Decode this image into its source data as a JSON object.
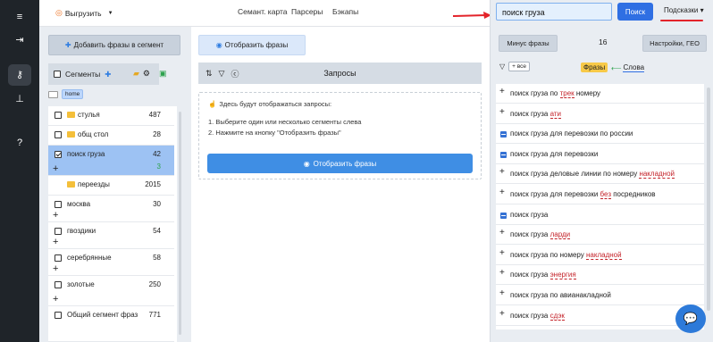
{
  "rail": {
    "icons": [
      "menu-icon",
      "logout-icon",
      "key-icon",
      "sitemap-icon",
      "help-icon"
    ]
  },
  "header": {
    "export_label": "Выгрузить",
    "nav": [
      "Семант. карта",
      "Парсеры",
      "Бэкапы"
    ]
  },
  "segments": {
    "add_label": "Добавить фразы в сегмент",
    "title": "Сегменты",
    "home_tag": "home",
    "items": [
      {
        "name": "стулья",
        "count": "487",
        "folder": true,
        "checkbox": true,
        "plus": false
      },
      {
        "name": "общ стол",
        "count": "28",
        "folder": true,
        "checkbox": true,
        "plus": false
      },
      {
        "name": "поиск груза",
        "count": "42",
        "sub": "3",
        "folder": false,
        "checkbox": true,
        "selected": true,
        "plus": true
      },
      {
        "name": "переезды",
        "count": "2015",
        "folder": true,
        "checkbox": false,
        "plus": false
      },
      {
        "name": "москва",
        "count": "30",
        "folder": false,
        "checkbox": true,
        "plus": true
      },
      {
        "name": "гвоздики",
        "count": "54",
        "folder": false,
        "checkbox": true,
        "plus": true
      },
      {
        "name": "серебрянные",
        "count": "58",
        "folder": false,
        "checkbox": true,
        "plus": true
      },
      {
        "name": "золотые",
        "count": "250",
        "folder": false,
        "checkbox": true,
        "plus": true
      },
      {
        "name": "Общий сегмент фраз",
        "count": "771",
        "folder": false,
        "checkbox": true,
        "plus": false
      }
    ]
  },
  "queries": {
    "show_top_label": "Отобразить фразы",
    "title": "Запросы",
    "hint": "Здесь будут отображаться запросы:",
    "steps": [
      "1. Выберите один или несколько сегменты слева",
      "2. Нажмите на кнопку \"Отобразить фразы\""
    ],
    "show_label": "Отобразить фразы"
  },
  "search": {
    "value": "поиск груза",
    "button": "Поиск",
    "hints_label": "Подсказки"
  },
  "results": {
    "minus_label": "Минус фразы",
    "count": "16",
    "settings_label": "Настройки, ГЕО",
    "all_label": "+ все",
    "phrases_label": "Фразы",
    "words_label": "Слова",
    "rows": [
      {
        "type": "plus",
        "text": "поиск груза по ",
        "hl": "трек",
        "tail": " номеру"
      },
      {
        "type": "plus",
        "text": "поиск груза ",
        "hl": "ати",
        "tail": ""
      },
      {
        "type": "minus",
        "text": "поиск груза для перевозки по россии",
        "hl": "",
        "tail": ""
      },
      {
        "type": "minus",
        "text": "поиск груза для перевозки",
        "hl": "",
        "tail": ""
      },
      {
        "type": "plus",
        "text": "поиск груза деловые линии по номеру ",
        "hl": "накладной",
        "tail": ""
      },
      {
        "type": "plus",
        "text": "поиск груза для перевозки ",
        "hl": "без",
        "tail": " посредников"
      },
      {
        "type": "minus",
        "text": "поиск груза",
        "hl": "",
        "tail": ""
      },
      {
        "type": "plus",
        "text": "поиск груза ",
        "hl": "ларди",
        "tail": ""
      },
      {
        "type": "plus",
        "text": "поиск груза по номеру ",
        "hl": "накладной",
        "tail": ""
      },
      {
        "type": "plus",
        "text": "поиск груза ",
        "hl": "энергия",
        "tail": ""
      },
      {
        "type": "plus",
        "text": "поиск груза по авианакладной",
        "hl": "",
        "tail": ""
      },
      {
        "type": "plus",
        "text": "поиск груза ",
        "hl": "сдэк",
        "tail": ""
      }
    ]
  },
  "colors": {
    "accent": "#2f6fe3",
    "annotation": "#e3232a",
    "sidebar": "#1f2429"
  }
}
